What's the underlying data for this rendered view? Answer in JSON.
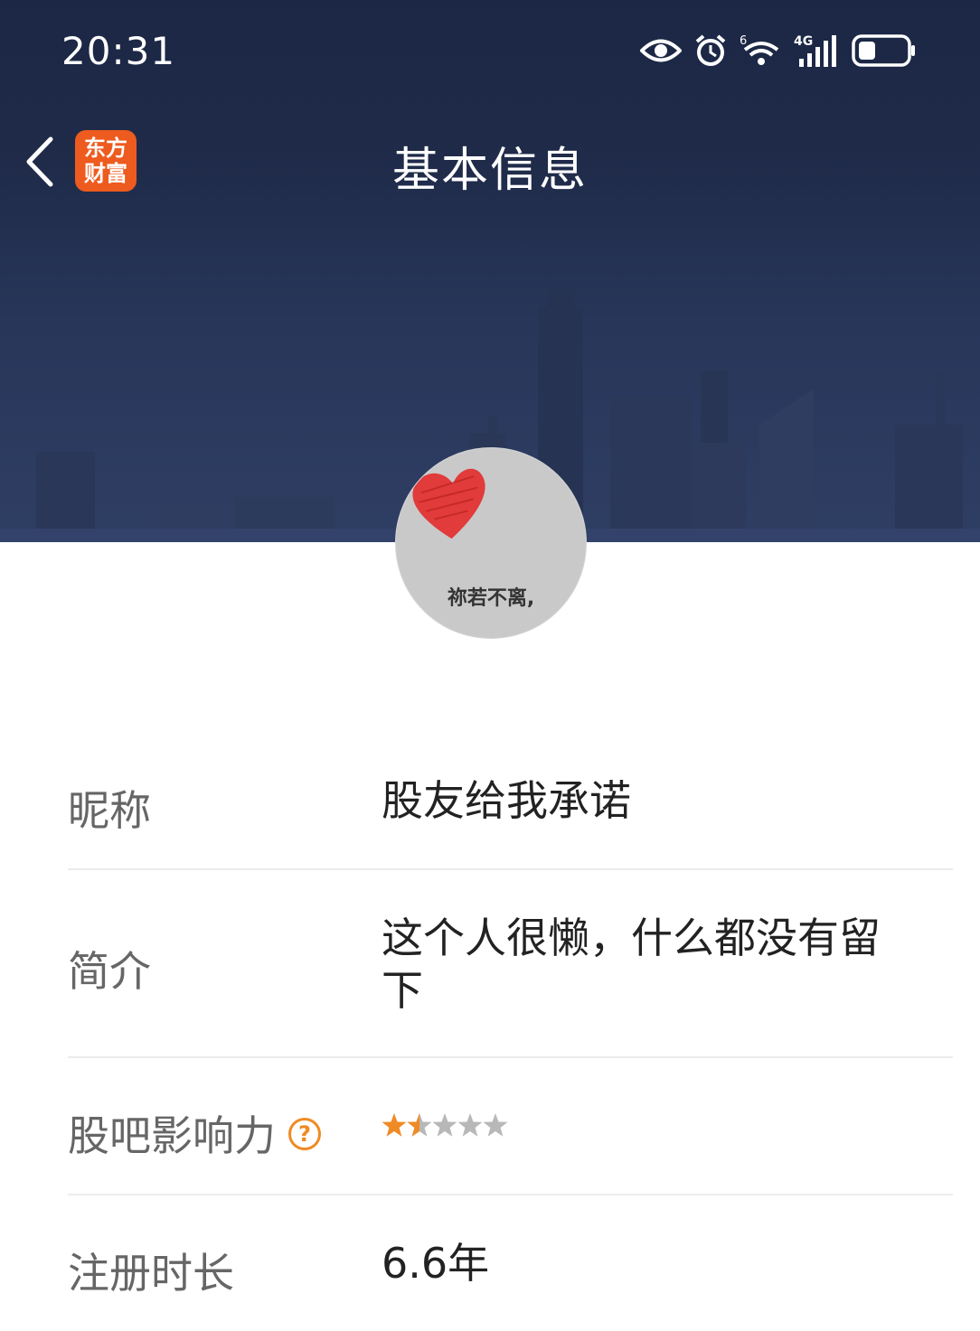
{
  "status_bar": {
    "time": "20:31",
    "network_label": "4G",
    "wifi_label": "6"
  },
  "nav": {
    "title": "基本信息",
    "logo_line1": "东方",
    "logo_line2": "财富"
  },
  "avatar": {
    "caption": "祢若不离,"
  },
  "rows": [
    {
      "label": "昵称",
      "value": "股友给我承诺"
    },
    {
      "label": "简介",
      "value_line1": "这个人很懒，什么都没有留",
      "value_line2": "下"
    },
    {
      "label": "股吧影响力",
      "help_symbol": "?",
      "rating": 1.5,
      "rating_max": 5
    },
    {
      "label": "注册时长",
      "value": "6.6年"
    }
  ],
  "colors": {
    "header": "#1f2b49",
    "accent": "#f08a24",
    "logo": "#ee5b1f",
    "star_empty": "#b8b8b8"
  }
}
